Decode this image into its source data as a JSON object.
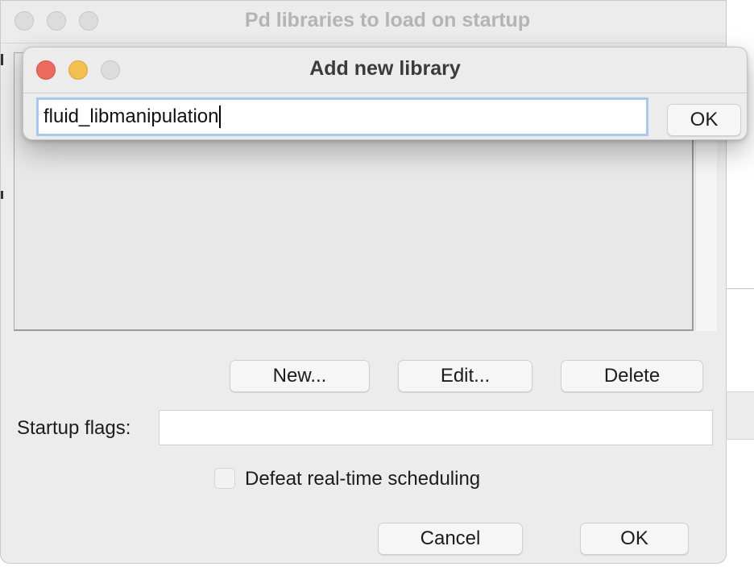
{
  "main_window": {
    "title": "Pd libraries to load on startup",
    "buttons": {
      "new": "New...",
      "edit": "Edit...",
      "delete": "Delete",
      "cancel": "Cancel",
      "ok": "OK"
    },
    "startup_flags_label": "Startup flags:",
    "startup_flags_value": "",
    "checkbox_label": "Defeat real-time scheduling",
    "checkbox_checked": false
  },
  "dialog": {
    "title": "Add new library",
    "input_value": "fluid_libmanipulation",
    "ok_label": "OK"
  },
  "colors": {
    "close": "#ec6a5e",
    "minimize": "#f4bf4f",
    "inactive": "#dcdcdc",
    "focus_ring": "#a8c8ee"
  }
}
